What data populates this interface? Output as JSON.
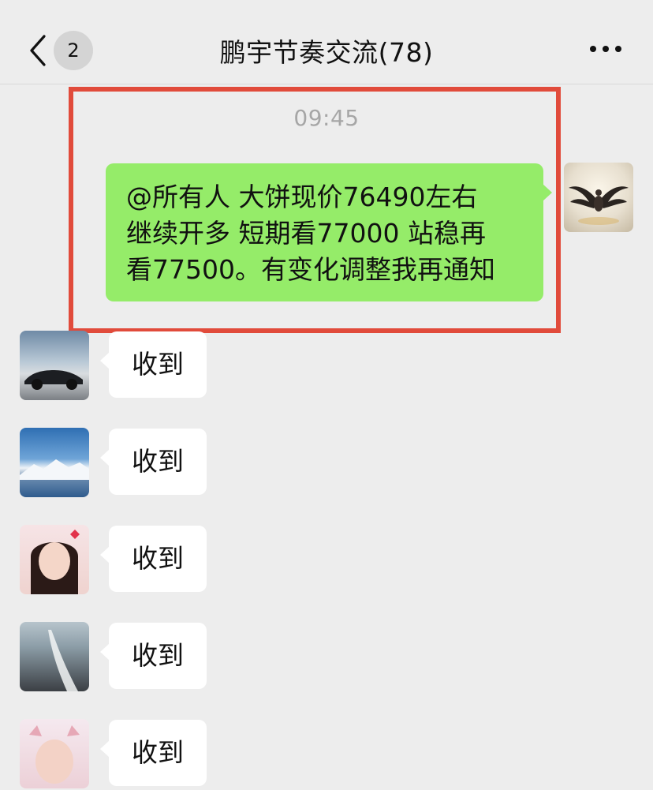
{
  "nav": {
    "unread_count": "2",
    "title": "鹏宇节奏交流(78)"
  },
  "chat": {
    "timestamp": "09:45",
    "my_message": "@所有人  大饼现价76490左右\n继续开多  短期看77000 站稳再\n看77500。有变化调整我再通知",
    "replies": [
      {
        "text": "收到",
        "avatar": "sports-car-avatar"
      },
      {
        "text": "收到",
        "avatar": "snow-mountain-avatar"
      },
      {
        "text": "收到",
        "avatar": "girl-portrait-avatar"
      },
      {
        "text": "收到",
        "avatar": "black-sand-beach-avatar"
      },
      {
        "text": "收到",
        "avatar": "child-portrait-avatar"
      }
    ]
  },
  "colors": {
    "background": "#ededed",
    "my_bubble": "#95ec69",
    "other_bubble": "#ffffff",
    "highlight_border": "#e14b3b",
    "timestamp": "#a6a6a6"
  }
}
